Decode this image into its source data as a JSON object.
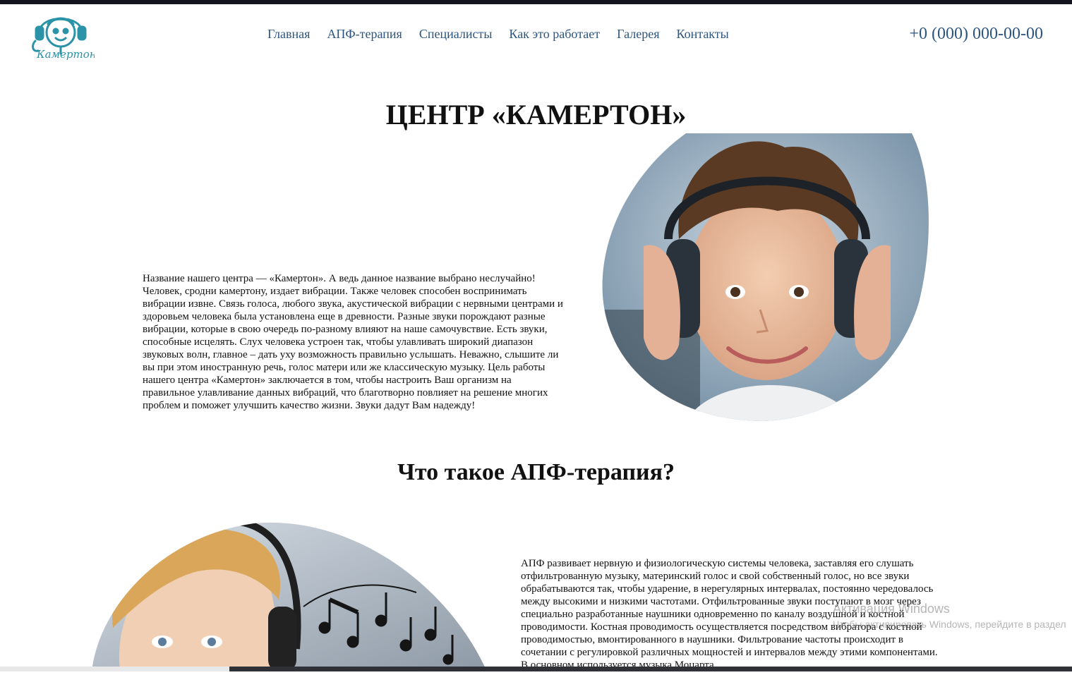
{
  "header": {
    "logo_text": "Камертон",
    "nav": [
      {
        "label": "Главная"
      },
      {
        "label": "АПФ-терапия"
      },
      {
        "label": "Специалисты"
      },
      {
        "label": "Как это работает"
      },
      {
        "label": "Галерея"
      },
      {
        "label": "Контакты"
      }
    ],
    "phone": "+0 (000) 000-00-00"
  },
  "intro": {
    "title": "ЦЕНТР «КАМЕРТОН»",
    "text": "Название нашего центра — «Камертон». А ведь данное название выбрано неслучайно! Человек, сродни камертону, издает вибрации. Также человек способен воспринимать вибрации извне. Связь голоса, любого звука, акустической вибрации с нервными центрами и здоровьем человека была установлена еще в древности. Разные звуки порождают разные вибрации, которые в свою очередь по-разному влияют на наше самочувствие. Есть звуки, способные исцелять. Слух человека устроен так, чтобы улавливать широкий диапазон звуковых волн, главное – дать уху возможность правильно услышать. Неважно, слышите ли вы при этом иностранную речь, голос матери или же классическую музыку. Цель работы нашего центра «Камертон» заключается в том, чтобы настроить Ваш организм на правильное улавливание данных вибраций, что благотворно повлияет на решение многих проблем и поможет улучшить качество жизни. Звуки дадут Вам надежду!"
  },
  "apf": {
    "title": "Что такое АПФ-терапия?",
    "text": "АПФ развивает нервную и физиологическую системы человека, заставляя его слушать отфильтрованную музыку, материнский голос и свой собственный голос, но все звуки обрабатываются так, чтобы ударение, в нерегулярных интервалах, постоянно чередовалось между высокими и низкими частотами. Отфильтрованные звуки поступают в мозг через специально разработанные наушники одновременно по каналу воздушной и костной проводимости. Костная проводимость осуществляется посредством вибратора с костной проводимостью, вмонтированного в наушники. Фильтрование частоты происходит в сочетании с регулировкой различных мощностей и интервалов между этими компонентами. В основном используется музыка Моцарта"
  },
  "watermark": {
    "title": "Активация Windows",
    "subtitle": "Чтобы активировать Windows, перейдите в раздел"
  },
  "colors": {
    "accent": "#2b5580",
    "logo": "#2a93a8",
    "topbar": "#14141f"
  }
}
